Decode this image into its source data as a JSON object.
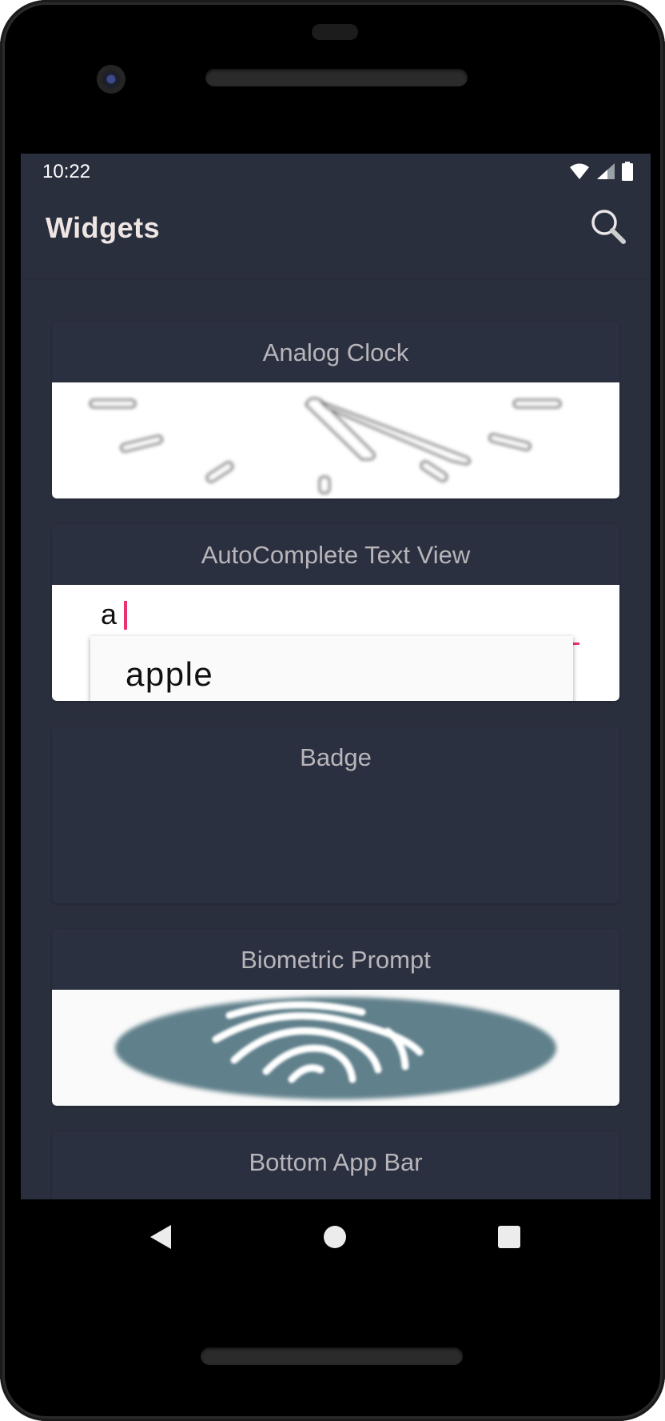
{
  "status_bar": {
    "time": "10:22"
  },
  "app_bar": {
    "title": "Widgets",
    "search_icon": "search-icon"
  },
  "widgets": [
    {
      "title": "Analog Clock"
    },
    {
      "title": "AutoComplete Text View",
      "input_value": "a",
      "suggestion": "apple"
    },
    {
      "title": "Badge"
    },
    {
      "title": "Biometric Prompt"
    },
    {
      "title": "Bottom App Bar"
    }
  ],
  "nav_bar": {
    "back_icon": "back-triangle-icon",
    "home_icon": "home-circle-icon",
    "recents_icon": "recents-square-icon"
  },
  "colors": {
    "background": "#2a2f3e",
    "accent": "#e8336e",
    "text_muted": "#b7b5b9"
  }
}
